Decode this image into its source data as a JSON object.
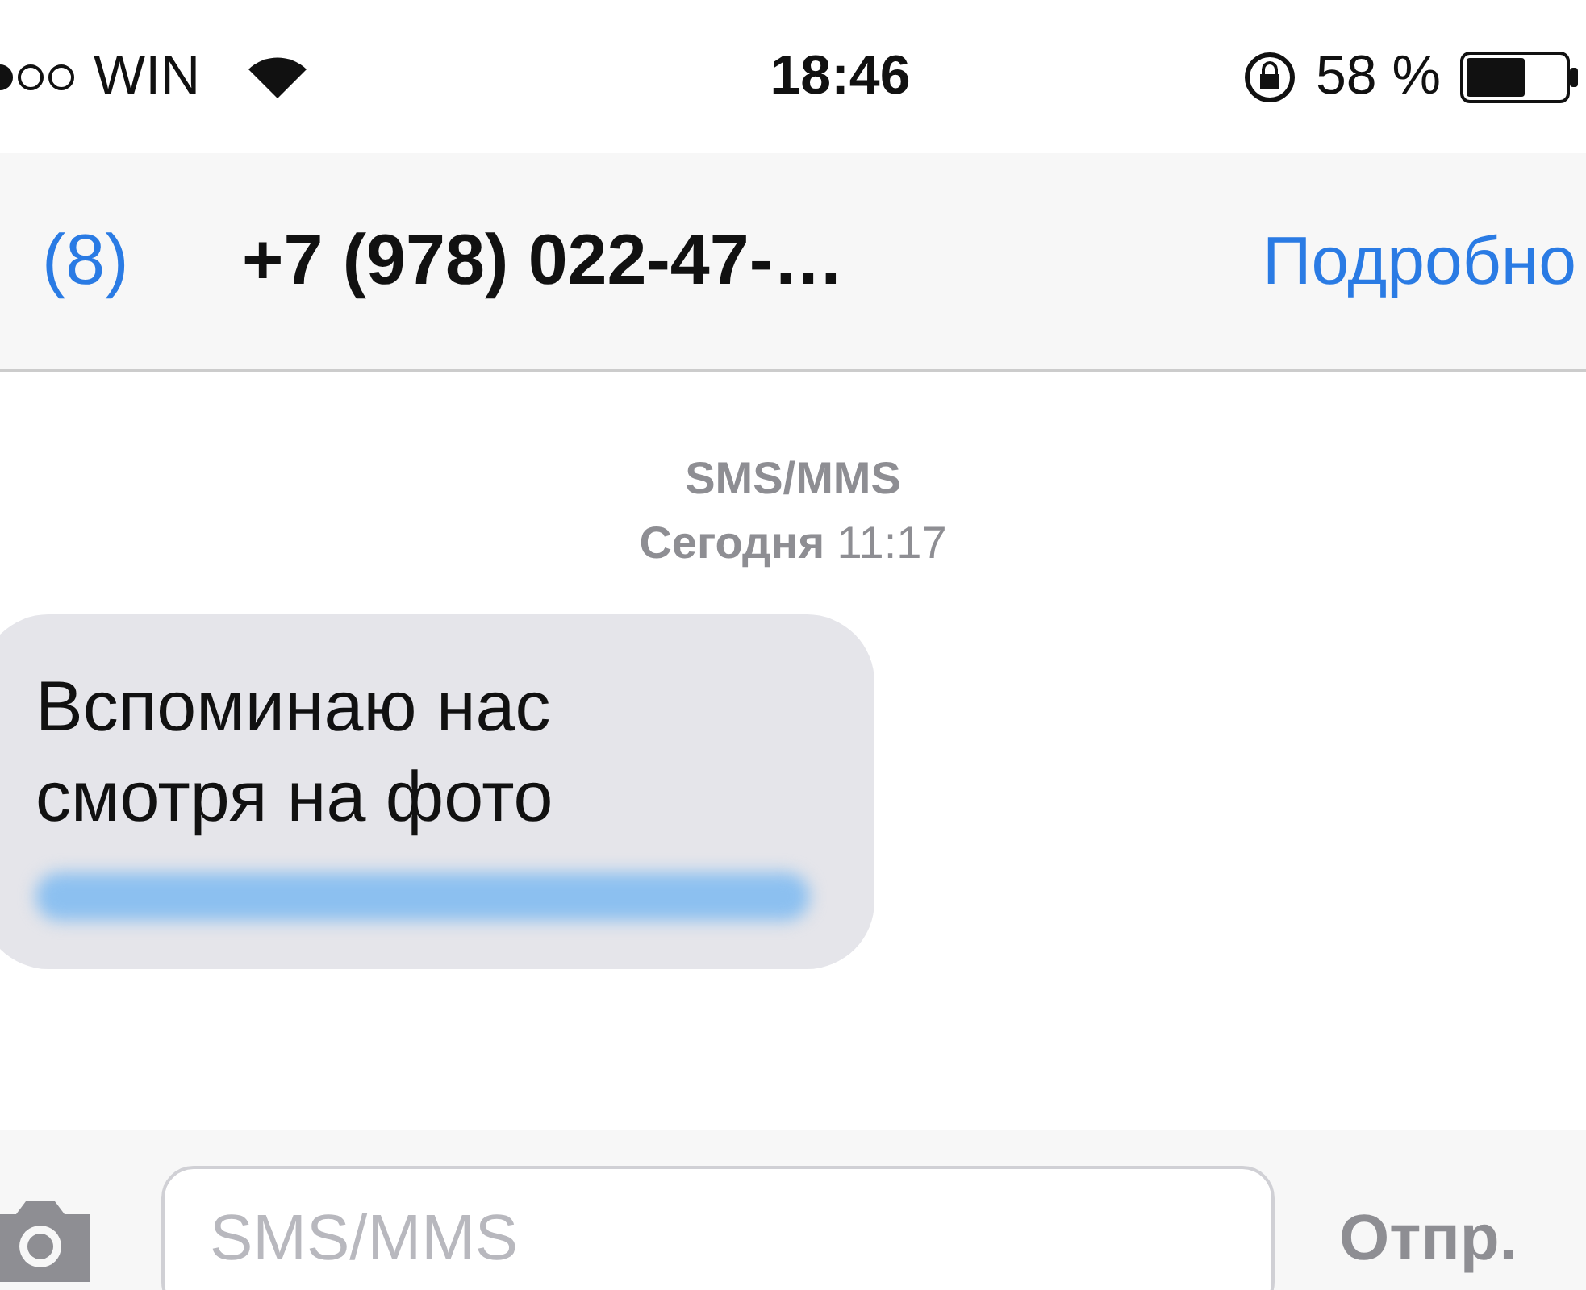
{
  "status_bar": {
    "carrier": "WIN",
    "time": "18:46",
    "battery": "58 %"
  },
  "nav": {
    "back": "(8)",
    "title": "+7 (978) 022-47-…",
    "details": "Подробно"
  },
  "thread": {
    "service": "SMS/MMS",
    "date": "**Сегодня** 11:17",
    "messages": [
      {
        "kind": "incoming",
        "text": "Вспоминаю нас\nсмотря на фото"
      }
    ]
  },
  "composer": {
    "placeholder": "SMS/MMS",
    "send": "Отпр."
  }
}
